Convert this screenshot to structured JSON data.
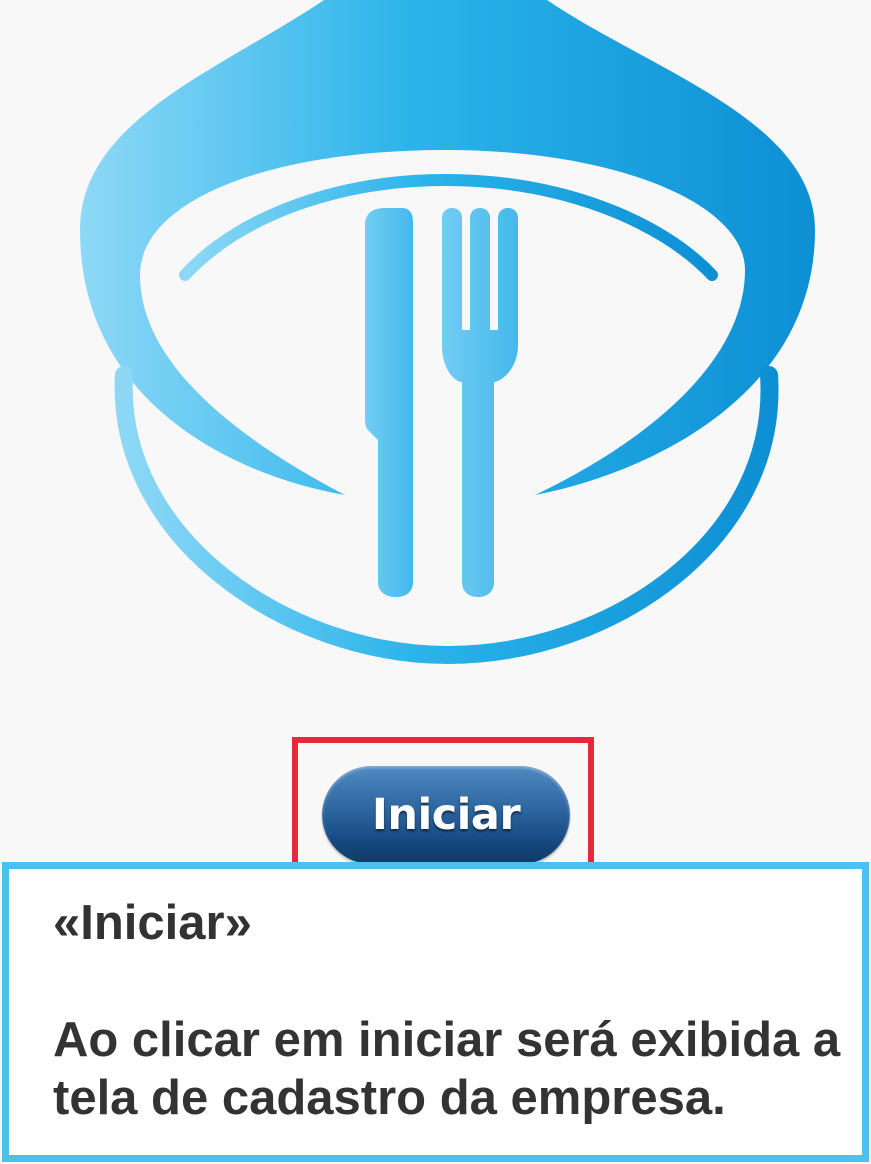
{
  "colors": {
    "logo_blue_light": "#8ed8f6",
    "logo_blue": "#2bb4ea",
    "logo_blue_dark": "#0d8fd4",
    "button_top": "#4f8ac1",
    "button_bottom": "#0f3a68",
    "highlight_border": "#e6283a",
    "callout_border": "#4cc1ef",
    "text": "#333333"
  },
  "logo": {
    "icon": "fork-and-knife-in-water-drop-icon"
  },
  "button": {
    "label": "Iniciar"
  },
  "callout": {
    "title": "«Iniciar»",
    "description": "Ao clicar em iniciar será exibida a tela de cadastro da empresa."
  }
}
